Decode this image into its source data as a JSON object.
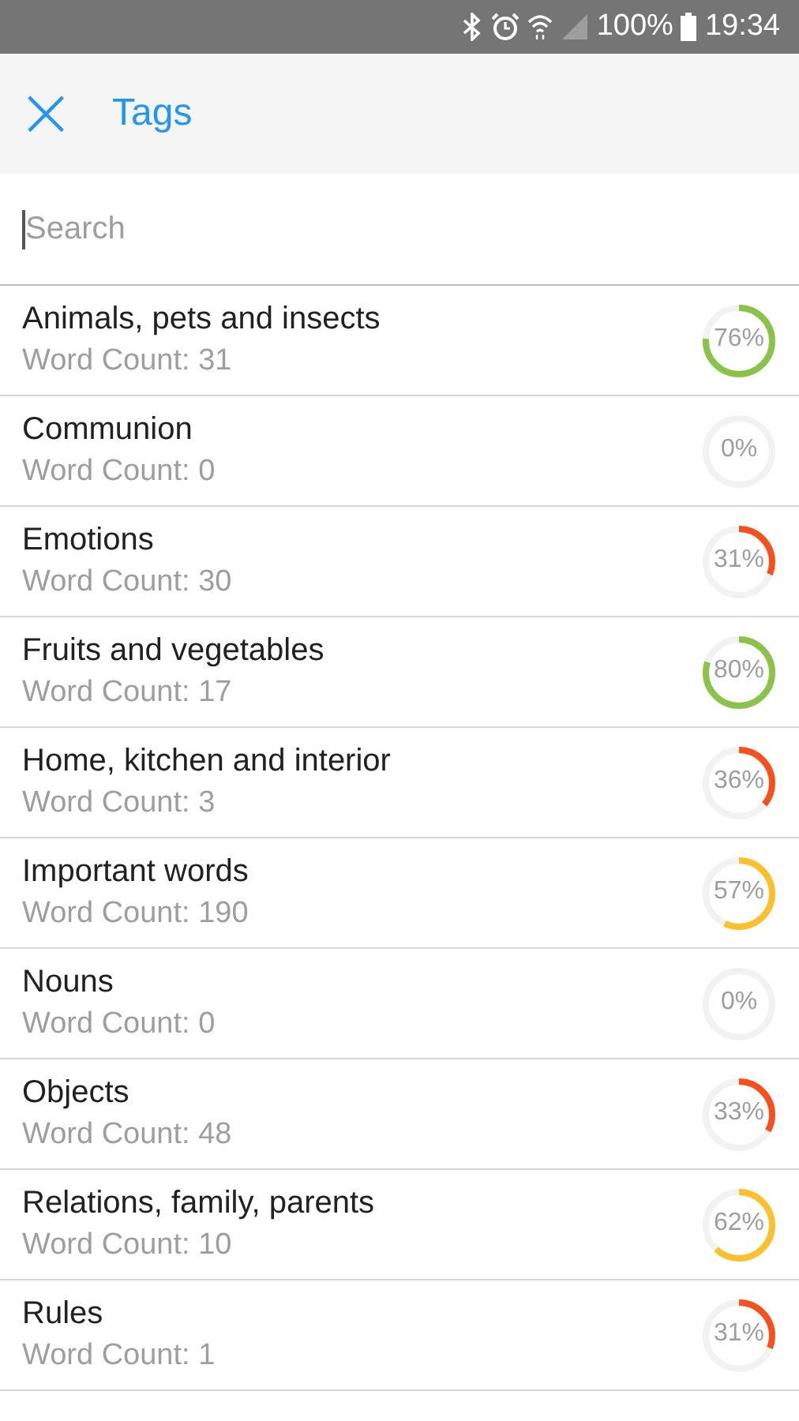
{
  "status_bar": {
    "battery": "100%",
    "time": "19:34"
  },
  "toolbar": {
    "close": "×",
    "title": "Tags"
  },
  "search": {
    "placeholder": "Search"
  },
  "tags": [
    {
      "name": "Animals, pets and insects",
      "count": "Word Count: 31",
      "percent": "76%",
      "level": 0.76
    },
    {
      "name": "Communion",
      "count": "Word Count: 0",
      "percent": "0%",
      "level": 0
    },
    {
      "name": "Emotions",
      "count": "Word Count: 30",
      "percent": "31%",
      "level": 0.31
    },
    {
      "name": "Fruits and vegetables",
      "count": "Word Count: 17",
      "percent": "80%",
      "level": 0.8
    },
    {
      "name": "Home, kitchen and interior",
      "count": "Word Count: 3",
      "percent": "36%",
      "level": 0.36
    },
    {
      "name": "Important words",
      "count": "Word Count: 190",
      "percent": "57%",
      "level": 0.57
    },
    {
      "name": "Nouns",
      "count": "Word Count: 0",
      "percent": "0%",
      "level": 0
    },
    {
      "name": "Objects",
      "count": "Word Count: 48",
      "percent": "33%",
      "level": 0.33
    },
    {
      "name": "Relations, family, parents",
      "count": "Word Count: 10",
      "percent": "62%",
      "level": 0.62
    },
    {
      "name": "Rules",
      "count": "Word Count: 1",
      "percent": "31%",
      "level": 0.31
    }
  ]
}
